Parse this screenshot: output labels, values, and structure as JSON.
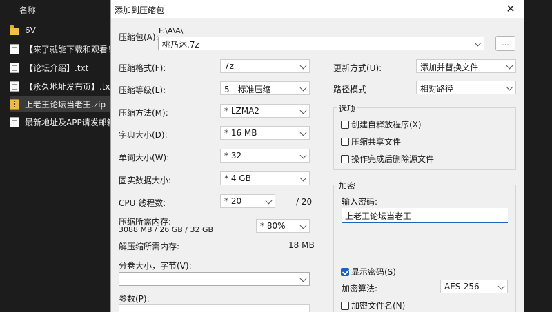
{
  "explorer": {
    "header": "名称",
    "items": [
      {
        "label": "6V",
        "type": "folder"
      },
      {
        "label": "【来了就能下载和观看！",
        "type": "file"
      },
      {
        "label": "【论坛介绍】.txt",
        "type": "file"
      },
      {
        "label": "【永久地址发布页】.txt",
        "type": "file"
      },
      {
        "label": "上老王论坛当老王.zip",
        "type": "zip"
      },
      {
        "label": "最新地址及APP请发邮箱",
        "type": "file"
      }
    ]
  },
  "dialog": {
    "title": "添加到压缩包",
    "archive": {
      "label": "压缩包(A):",
      "path": "F:\\A\\A\\",
      "name": "桃乃沐.7z",
      "browse": "..."
    },
    "left": {
      "format": {
        "label": "压缩格式(F):",
        "value": "7z"
      },
      "level": {
        "label": "压缩等级(L):",
        "value": "5 - 标准压缩"
      },
      "method": {
        "label": "压缩方法(M):",
        "value": "* LZMA2"
      },
      "dict": {
        "label": "字典大小(D):",
        "value": "* 16 MB"
      },
      "word": {
        "label": "单词大小(W):",
        "value": "* 32"
      },
      "solid": {
        "label": "固实数据大小:",
        "value": "* 4 GB"
      },
      "threads": {
        "label": "CPU 线程数:",
        "value": "* 20",
        "max": "/ 20"
      },
      "mem_label": "压缩所需内存:",
      "mem_detail": "3088 MB / 26 GB / 32 GB",
      "mem_value": "* 80%",
      "decomp_label": "解压缩所需内存:",
      "decomp_value": "18 MB",
      "split_label": "分卷大小，字节(V):",
      "split_value": "",
      "params_label": "参数(P):"
    },
    "right": {
      "update": {
        "label": "更新方式(U):",
        "value": "添加并替换文件"
      },
      "path": {
        "label": "路径模式",
        "value": "相对路径"
      },
      "options": {
        "title": "选项",
        "sfx": "创建自释放程序(X)",
        "shared": "压缩共享文件",
        "delete": "操作完成后删除源文件"
      },
      "encryption": {
        "title": "加密",
        "password_label": "输入密码:",
        "password": "上老王论坛当老王",
        "show_password": "显示密码(S)",
        "method_label": "加密算法:",
        "method_value": "AES-256",
        "encrypt_names": "加密文件名(N)"
      }
    }
  }
}
